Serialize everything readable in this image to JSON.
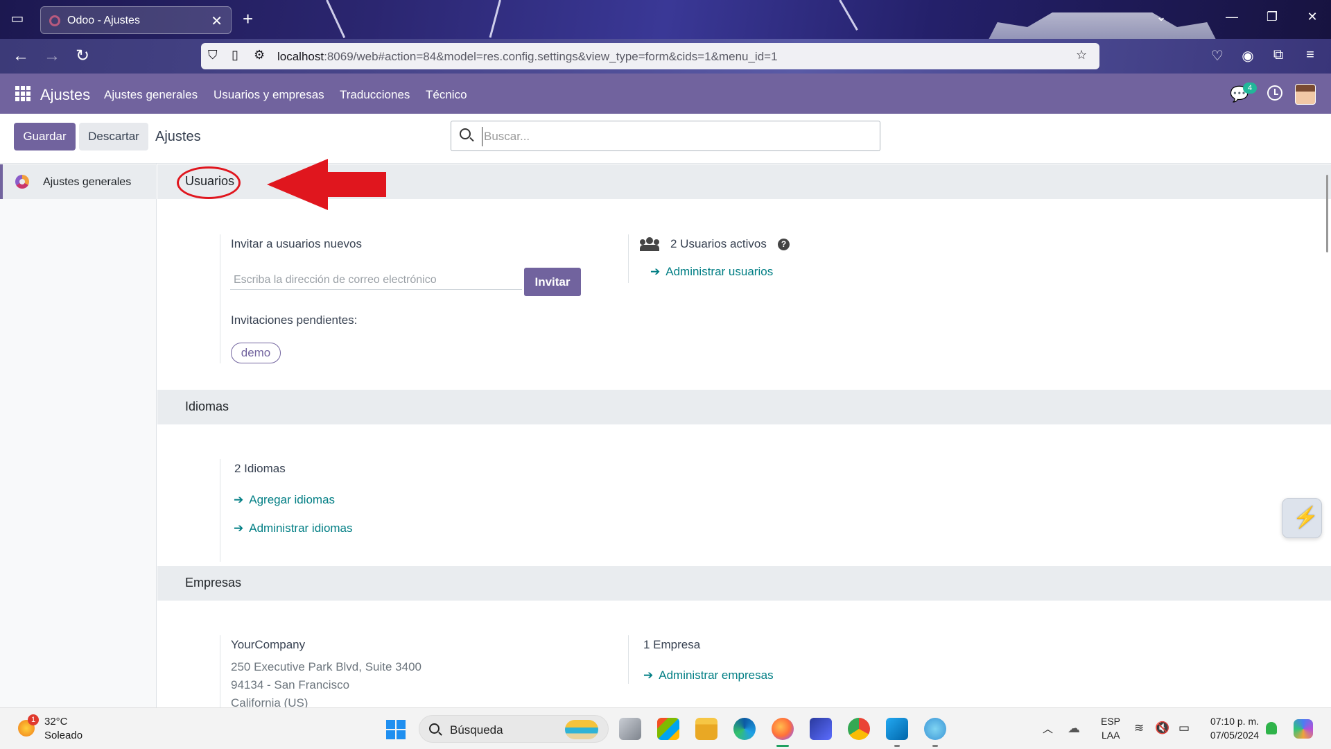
{
  "browser": {
    "tab_title": "Odoo - Ajustes",
    "url_host": "localhost",
    "url_rest": ":8069/web#action=84&model=res.config.settings&view_type=form&cids=1&menu_id=1"
  },
  "navbar": {
    "app_name": "Ajustes",
    "menu": [
      "Ajustes generales",
      "Usuarios y empresas",
      "Traducciones",
      "Técnico"
    ],
    "chat_count": "4"
  },
  "control_panel": {
    "save_label": "Guardar",
    "discard_label": "Descartar",
    "title": "Ajustes",
    "search_placeholder": "Buscar..."
  },
  "sidebar": {
    "items": [
      {
        "label": "Ajustes generales",
        "icon": "odoo-app-icon",
        "active": true
      }
    ]
  },
  "sections": {
    "usuarios": {
      "title": "Usuarios",
      "invite_label": "Invitar a usuarios nuevos",
      "email_placeholder": "Escriba la dirección de correo electrónico",
      "invite_button": "Invitar",
      "pending_label": "Invitaciones pendientes:",
      "pending": [
        "demo"
      ],
      "active_users": "2 Usuarios activos",
      "manage_users": "Administrar usuarios"
    },
    "idiomas": {
      "title": "Idiomas",
      "count": "2 Idiomas",
      "add_link": "Agregar idiomas",
      "manage_link": "Administrar idiomas"
    },
    "empresas": {
      "title": "Empresas",
      "company_name": "YourCompany",
      "address_line1": "250 Executive Park Blvd, Suite 3400",
      "address_line2": "94134 - San Francisco",
      "address_line3": "California (US)",
      "company_count": "1 Empresa",
      "manage_link": "Administrar empresas"
    }
  },
  "taskbar": {
    "weather_temp": "32°C",
    "weather_desc": "Soleado",
    "weather_badge": "1",
    "search_label": "Búsqueda",
    "lang_top": "ESP",
    "lang_bottom": "LAA",
    "time": "07:10 p. m.",
    "date": "07/05/2024"
  },
  "colors": {
    "brand": "#71639e",
    "link": "#017e84",
    "annotation": "#e0161e",
    "section_bg": "#e9ecef"
  }
}
